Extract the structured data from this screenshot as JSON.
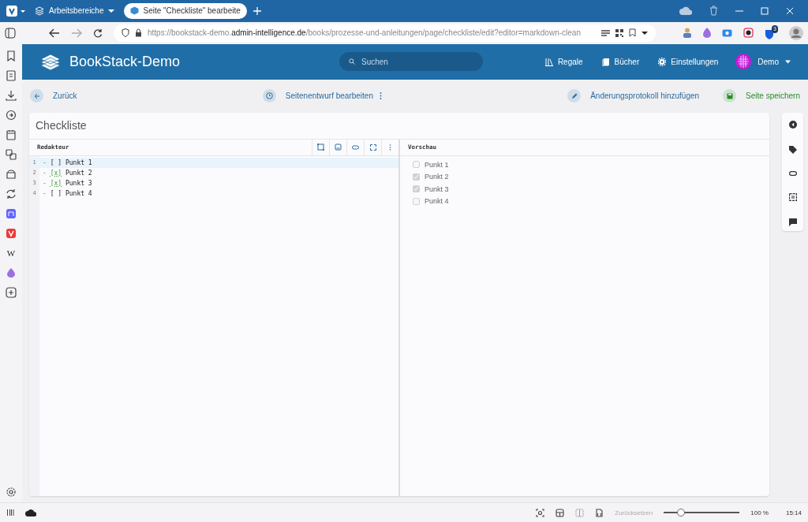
{
  "browser": {
    "workspace": "Arbeitsbereiche",
    "tabs": [
      {
        "title": "Seite \"Checkliste\" bearbeite",
        "selected": true
      }
    ],
    "url": {
      "prefix": "https://bookstack-demo.",
      "domain": "admin-intelligence.de",
      "path": "/books/prozesse-und-anleitungen/page/checkliste/edit?editor=markdown-clean"
    },
    "extension_badge": "3",
    "sidebar_letter": "W"
  },
  "app": {
    "brand": "BookStack-Demo",
    "search": {
      "placeholder": "Suchen"
    },
    "nav": [
      {
        "label": "Regale",
        "kind": "shelves"
      },
      {
        "label": "Bücher",
        "kind": "books"
      },
      {
        "label": "Einstellungen",
        "kind": "settings"
      }
    ],
    "user": "Demo"
  },
  "toolbar": {
    "back": "Zurück",
    "draft": "Seitenentwurf bearbeiten",
    "changelog": "Änderungsprotokoll hinzufügen",
    "save": "Seite speichern"
  },
  "page": {
    "title": "Checkliste",
    "editor_label": "Redakteur",
    "preview_label": "Vorschau",
    "lines": [
      {
        "number": "1",
        "bullet": "-",
        "task": "[ ]",
        "text": "Punkt 1",
        "checked": false,
        "active": true
      },
      {
        "number": "2",
        "bullet": "-",
        "task": "[x]",
        "text": "Punkt 2",
        "checked": true,
        "active": false
      },
      {
        "number": "3",
        "bullet": "-",
        "task": "[x]",
        "text": "Punkt 3",
        "checked": true,
        "active": false
      },
      {
        "number": "4",
        "bullet": "-",
        "task": "[ ]",
        "text": "Punkt 4",
        "checked": false,
        "active": false
      }
    ],
    "preview": [
      {
        "label": "Punkt 1",
        "checked": false
      },
      {
        "label": "Punkt 2",
        "checked": true
      },
      {
        "label": "Punkt 3",
        "checked": true
      },
      {
        "label": "Punkt 4",
        "checked": false
      }
    ]
  },
  "status_bar": {
    "reset": "Zurücksetzen",
    "zoom": {
      "level": 0.2,
      "reading": "100 %"
    },
    "time": "15:14"
  }
}
